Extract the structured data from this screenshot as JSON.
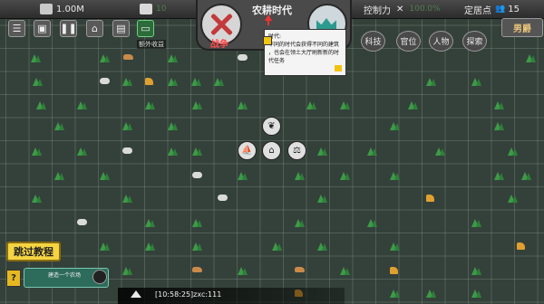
{
  "topbar": {
    "money": "1.00M",
    "food": "10",
    "control_label": "控制力",
    "control_value": "100.0%",
    "settlement_label": "定居点",
    "settlement_count": "15"
  },
  "toolbar": {
    "menu_icon": "menu-icon",
    "pause_icon": "pause-icon",
    "bank_icon": "bank-icon",
    "book_icon": "book-icon",
    "overseas_label": "额外收益"
  },
  "center": {
    "war_label": "战争",
    "era_title": "农耕时代"
  },
  "tooltip": {
    "title": "时代:",
    "line1": "不同的时代会获得不同的建筑",
    "line2": "，也会在领土大厅刷新新的时",
    "line3": "代任务"
  },
  "right_menu": {
    "tech": "科技",
    "officer": "官位",
    "people": "人物",
    "expedition": "探索",
    "gender": "男爵"
  },
  "bottom": {
    "skip_tutorial": "跳过教程",
    "task_text": "建造一个农场",
    "chat_line": "[10:58:25]zxc:111"
  },
  "colors": {
    "grid_bg": "#34413a",
    "skip_yellow": "#f5d442",
    "war_red": "#ff4a4a"
  }
}
